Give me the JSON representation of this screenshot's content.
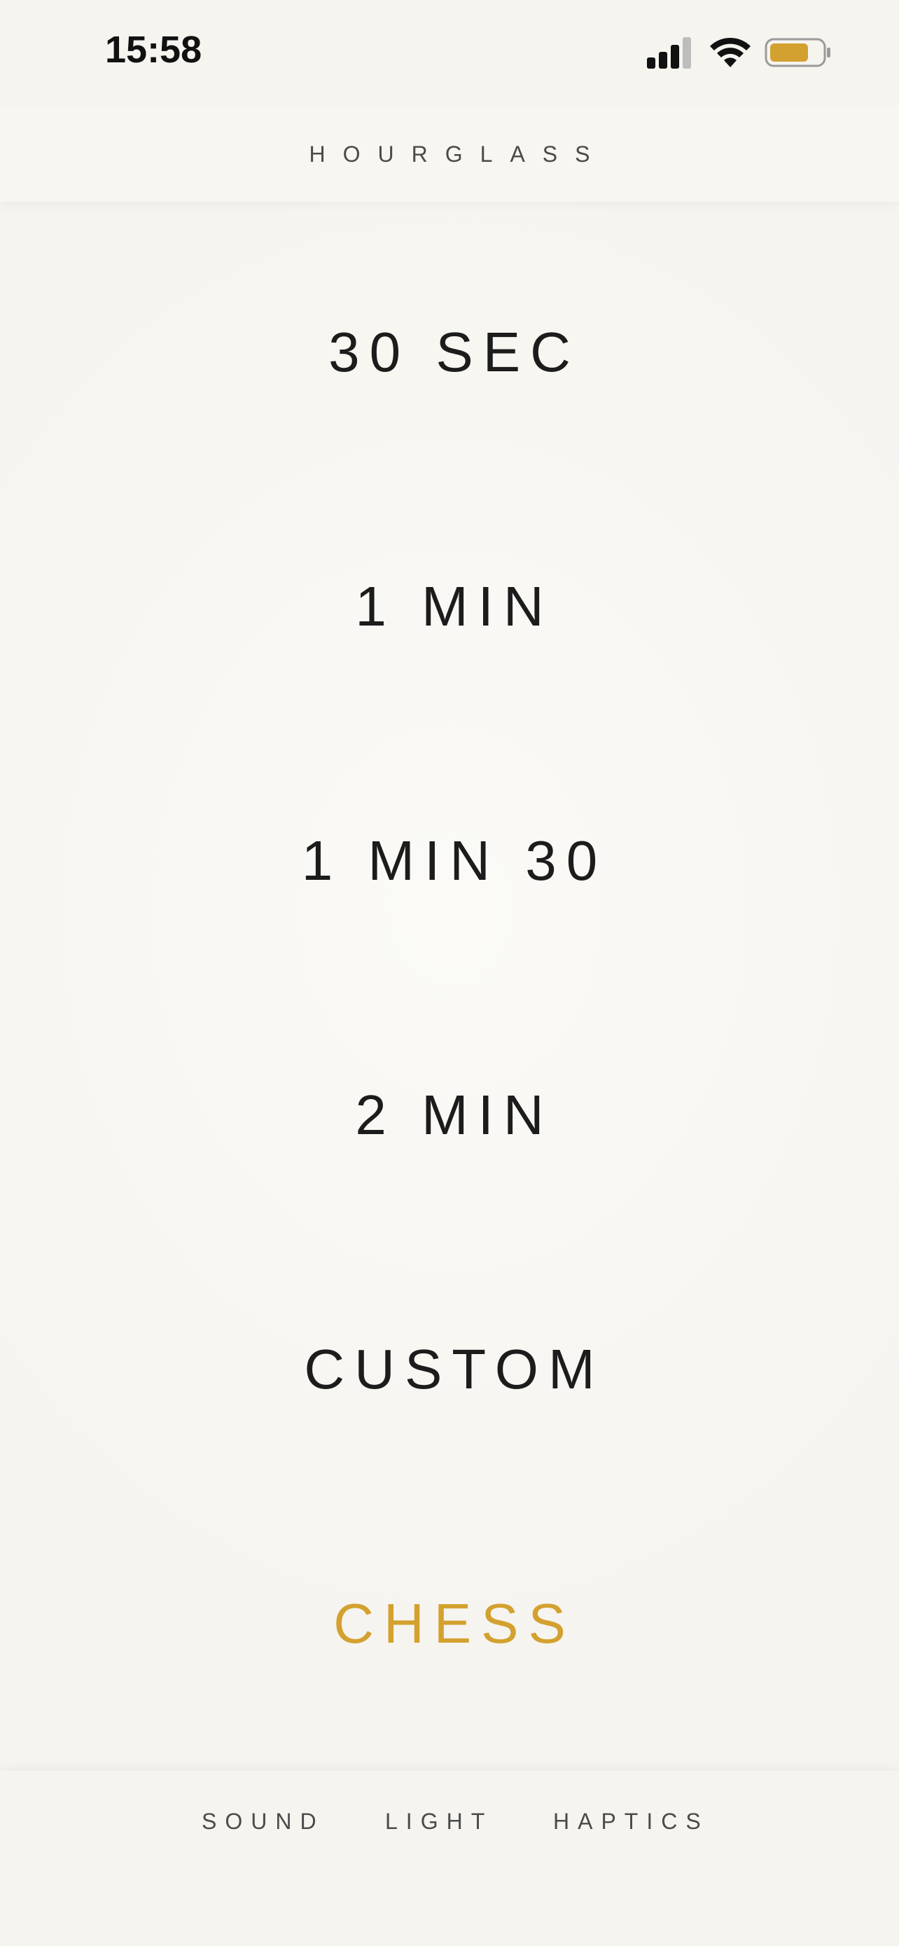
{
  "status_bar": {
    "time": "15:58",
    "icons": [
      "signal-icon",
      "wifi-icon",
      "battery-icon"
    ],
    "battery_color": "#d3a12f"
  },
  "header": {
    "title": "HOURGLASS"
  },
  "options": [
    {
      "label": "30 SEC"
    },
    {
      "label": "1 MIN"
    },
    {
      "label": "1 MIN 30"
    },
    {
      "label": "2 MIN"
    },
    {
      "label": "CUSTOM"
    },
    {
      "label": "CHESS",
      "accent": true
    }
  ],
  "bottom_bar": {
    "sound": "SOUND",
    "light": "LIGHT",
    "haptics": "HAPTICS"
  },
  "colors": {
    "accent": "#d3a12f",
    "background": "#f8f6f1",
    "text": "#1c1c1c"
  }
}
